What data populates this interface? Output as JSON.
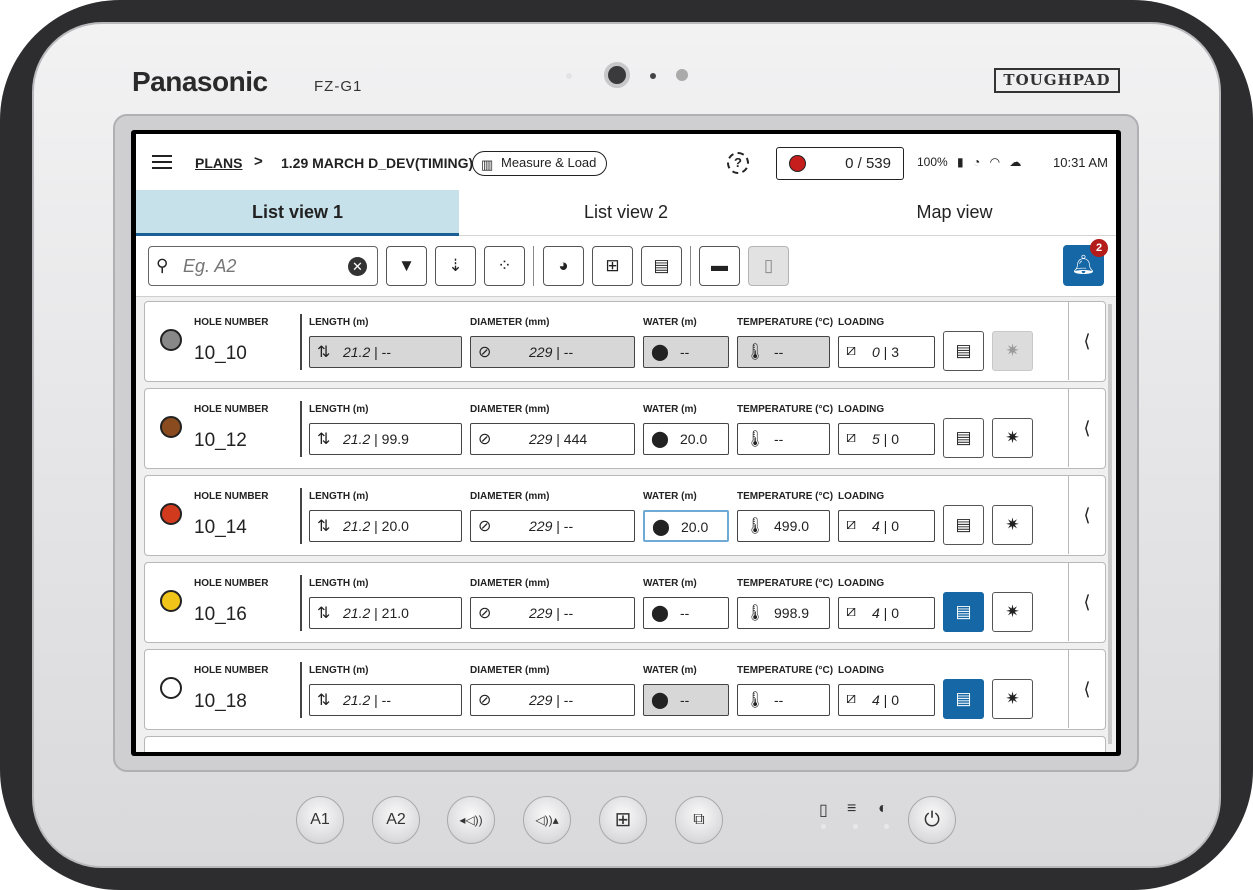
{
  "device": {
    "brand": "Panasonic",
    "model": "FZ-G1",
    "badge": "TOUGHPAD",
    "buttons": [
      "A1",
      "A2",
      "◂◁))",
      "◁))▴",
      "⊞",
      "⧉"
    ]
  },
  "header": {
    "breadcrumb_root": "PLANS",
    "breadcrumb_sep": ">",
    "plan_name": "1.29 MARCH D_DEV(TIMING)",
    "measure_label": "Measure & Load",
    "help_glyph": "?",
    "counter": "0 / 539",
    "battery": "100%",
    "time": "10:31 AM"
  },
  "tabs": [
    {
      "label": "List view 1",
      "active": true
    },
    {
      "label": "List view 2",
      "active": false
    },
    {
      "label": "Map view",
      "active": false
    }
  ],
  "search": {
    "placeholder": "Eg. A2",
    "value": ""
  },
  "notifications": {
    "count": "2"
  },
  "labels": {
    "hole_number": "HOLE NUMBER",
    "length": "LENGTH (m)",
    "diameter": "DIAMETER (mm)",
    "water": "WATER (m)",
    "temperature": "TEMPERATURE (°C)",
    "loading": "LOADING"
  },
  "rows": [
    {
      "hole": "10_10",
      "length_planned": "21.2",
      "length_actual": "--",
      "diameter_planned": "229",
      "diameter_actual": "--",
      "water": "--",
      "temperature": "--",
      "loading_a": "0",
      "loading_b": "3",
      "icon_color": "#888888"
    },
    {
      "hole": "10_12",
      "length_planned": "21.2",
      "length_actual": "99.9",
      "diameter_planned": "229",
      "diameter_actual": "444",
      "water": "20.0",
      "temperature": "--",
      "loading_a": "5",
      "loading_b": "0",
      "icon_color": "#8a4b1e"
    },
    {
      "hole": "10_14",
      "length_planned": "21.2",
      "length_actual": "20.0",
      "diameter_planned": "229",
      "diameter_actual": "--",
      "water": "20.0",
      "temperature": "499.0",
      "loading_a": "4",
      "loading_b": "0",
      "icon_color": "#d23a1e"
    },
    {
      "hole": "10_16",
      "length_planned": "21.2",
      "length_actual": "21.0",
      "diameter_planned": "229",
      "diameter_actual": "--",
      "water": "--",
      "temperature": "998.9",
      "loading_a": "4",
      "loading_b": "0",
      "icon_color": "#f0c419"
    },
    {
      "hole": "10_18",
      "length_planned": "21.2",
      "length_actual": "--",
      "diameter_planned": "229",
      "diameter_actual": "--",
      "water": "--",
      "temperature": "--",
      "loading_a": "4",
      "loading_b": "0",
      "icon_color": "#ffffff"
    }
  ],
  "colors": {
    "accent": "#1567a6",
    "active_tab": "#c7e1ea",
    "record": "#c61d1d"
  }
}
